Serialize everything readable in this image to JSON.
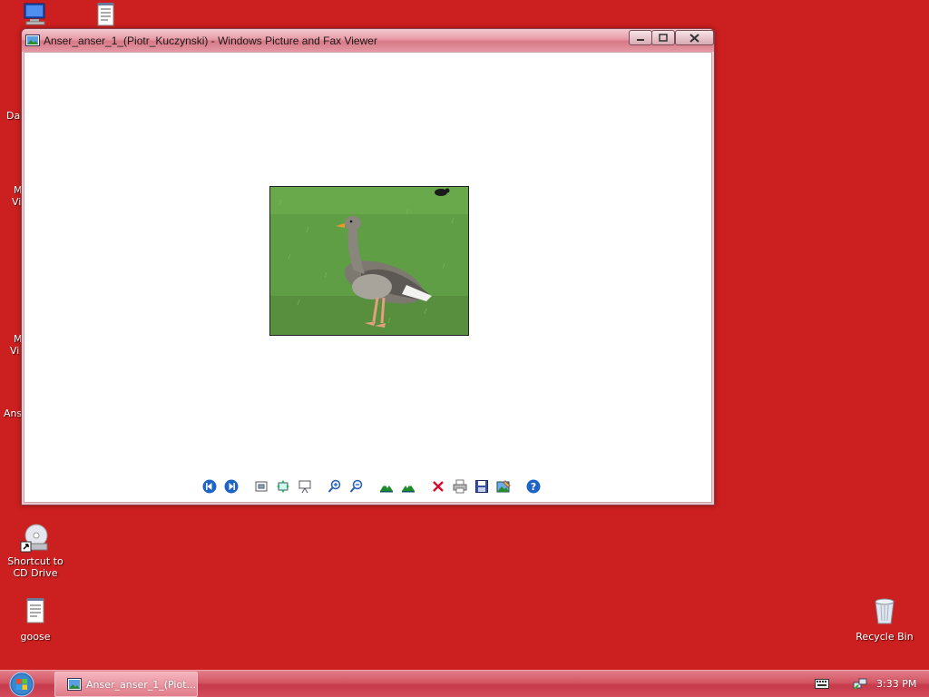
{
  "desktop": {
    "background_color": "#cc1f1f",
    "edge_labels": [
      "Da",
      "M",
      "Vi",
      "M",
      "Vi",
      "Ans"
    ],
    "icons": [
      {
        "label": "Shortcut to\nCD Drive",
        "icon": "cd-drive-icon"
      },
      {
        "label": "goose",
        "icon": "text-document-icon"
      },
      {
        "label": "Recycle Bin",
        "icon": "recycle-bin-icon"
      }
    ]
  },
  "window": {
    "title": "Anser_anser_1_(Piotr_Kuczynski) - Windows Picture and Fax Viewer",
    "controls": {
      "minimize": "minimize-icon",
      "maximize": "maximize-icon",
      "close": "close-icon"
    },
    "image_subject": "greylag goose on grass",
    "toolbar": [
      {
        "name": "previous-image-button",
        "icon": "previous-icon"
      },
      {
        "name": "next-image-button",
        "icon": "next-icon"
      },
      {
        "name": "best-fit-button",
        "icon": "best-fit-icon"
      },
      {
        "name": "actual-size-button",
        "icon": "actual-size-icon"
      },
      {
        "name": "slideshow-button",
        "icon": "slideshow-icon"
      },
      {
        "name": "zoom-in-button",
        "icon": "zoom-in-icon"
      },
      {
        "name": "zoom-out-button",
        "icon": "zoom-out-icon"
      },
      {
        "name": "rotate-clockwise-button",
        "icon": "rotate-clockwise-icon"
      },
      {
        "name": "rotate-counterclockwise-button",
        "icon": "rotate-counterclockwise-icon"
      },
      {
        "name": "delete-button",
        "icon": "delete-icon"
      },
      {
        "name": "print-button",
        "icon": "print-icon"
      },
      {
        "name": "save-button",
        "icon": "save-icon"
      },
      {
        "name": "edit-image-button",
        "icon": "edit-image-icon"
      },
      {
        "name": "help-button",
        "icon": "help-icon"
      }
    ]
  },
  "taskbar": {
    "start": "start-orb-icon",
    "task_label": "Anser_anser_1_(Piot...",
    "clock": "3:33 PM"
  }
}
